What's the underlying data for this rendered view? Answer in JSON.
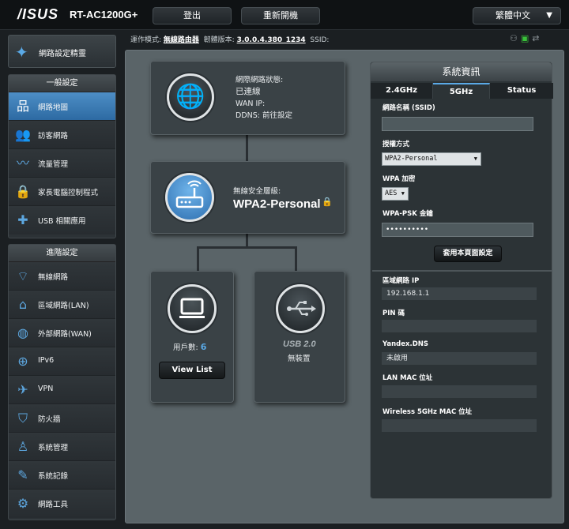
{
  "header": {
    "brand": "/ISUS",
    "model": "RT-AC1200G+",
    "logout_label": "登出",
    "reboot_label": "重新開機",
    "language_label": "繁體中文"
  },
  "statusline": {
    "mode_label": "運作模式:",
    "mode_value": "無線路由器",
    "firmware_label": "韌體版本:",
    "firmware_value": "3.0.0.4.380_1234",
    "ssid_label": "SSID:"
  },
  "sidebar": {
    "wizard_label": "網路設定精靈",
    "general_header": "一般設定",
    "general_items": [
      {
        "label": "網路地圖",
        "icon": "network-map-icon"
      },
      {
        "label": "訪客網路",
        "icon": "guest-network-icon"
      },
      {
        "label": "流量管理",
        "icon": "traffic-icon"
      },
      {
        "label": "家長電腦控制程式",
        "icon": "parental-control-icon"
      },
      {
        "label": "USB 相關應用",
        "icon": "usb-app-icon"
      }
    ],
    "advanced_header": "進階設定",
    "advanced_items": [
      {
        "label": "無線網路",
        "icon": "wireless-icon"
      },
      {
        "label": "區域網路(LAN)",
        "icon": "lan-icon"
      },
      {
        "label": "外部網路(WAN)",
        "icon": "wan-icon"
      },
      {
        "label": "IPv6",
        "icon": "ipv6-icon"
      },
      {
        "label": "VPN",
        "icon": "vpn-icon"
      },
      {
        "label": "防火牆",
        "icon": "firewall-icon"
      },
      {
        "label": "系統管理",
        "icon": "admin-icon"
      },
      {
        "label": "系統記錄",
        "icon": "syslog-icon"
      },
      {
        "label": "網路工具",
        "icon": "network-tools-icon"
      }
    ]
  },
  "map": {
    "internet": {
      "status_label": "網際網路狀態:",
      "status_value": "已連線",
      "wan_ip_label": "WAN IP:",
      "ddns_label": "DDNS:",
      "ddns_value": "前往設定"
    },
    "security": {
      "label": "無線安全層級:",
      "value": "WPA2-Personal"
    },
    "clients": {
      "label": "用戶數:",
      "count": "6",
      "button": "View List"
    },
    "usb": {
      "title": "USB 2.0",
      "status": "無裝置"
    }
  },
  "system_info": {
    "title": "系統資訊",
    "tabs": [
      "2.4GHz",
      "5GHz",
      "Status"
    ],
    "active_tab": "5GHz",
    "ssid_label": "網路名稱 (SSID)",
    "ssid_value": "",
    "auth_label": "授權方式",
    "auth_value": "WPA2-Personal",
    "wpa_enc_label": "WPA 加密",
    "wpa_enc_value": "AES",
    "psk_label": "WPA-PSK 金鑰",
    "psk_value": "••••••••••",
    "apply_label": "套用本頁面設定",
    "lan_ip_label": "區域網路 IP",
    "lan_ip_value": "192.168.1.1",
    "pin_label": "PIN 碼",
    "pin_value": "",
    "yandex_label": "Yandex.DNS",
    "yandex_value": "未啟用",
    "lan_mac_label": "LAN MAC 位址",
    "lan_mac_value": "",
    "wl_mac_label": "Wireless 5GHz MAC 位址",
    "wl_mac_value": ""
  },
  "colors": {
    "accent": "#5aa9e6",
    "active_nav": "#3b7cb7",
    "status_ok": "#39c13a"
  }
}
